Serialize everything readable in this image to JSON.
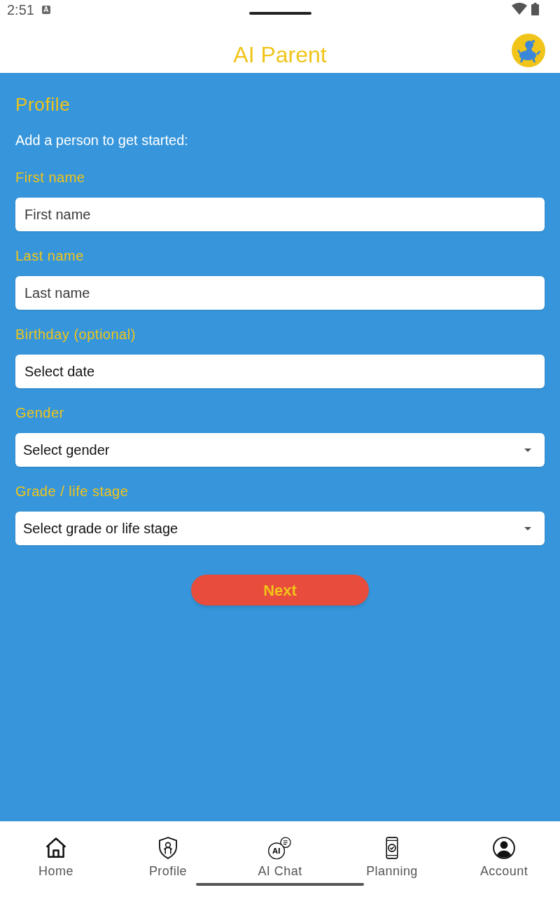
{
  "status_bar": {
    "time": "2:51",
    "notification": "A"
  },
  "app_bar": {
    "title": "AI Parent"
  },
  "page": {
    "heading": "Profile",
    "subtitle": "Add a person to get started:"
  },
  "fields": [
    {
      "label": "First name",
      "kind": "text",
      "placeholder": "First name"
    },
    {
      "label": "Last name",
      "kind": "text",
      "placeholder": "Last name"
    },
    {
      "label": "Birthday (optional)",
      "kind": "date",
      "placeholder": "Select date"
    },
    {
      "label": "Gender",
      "kind": "dropdown",
      "placeholder": "Select gender"
    },
    {
      "label": "Grade / life stage",
      "kind": "dropdown",
      "placeholder": "Select grade or life stage"
    }
  ],
  "next_button": {
    "label": "Next"
  },
  "bottom_nav": [
    {
      "label": "Home",
      "kind": "home"
    },
    {
      "label": "Profile",
      "kind": "profile"
    },
    {
      "label": "AI Chat",
      "kind": "chat",
      "icon_text": "AI"
    },
    {
      "label": "Planning",
      "kind": "planning"
    },
    {
      "label": "Account",
      "kind": "account"
    }
  ]
}
